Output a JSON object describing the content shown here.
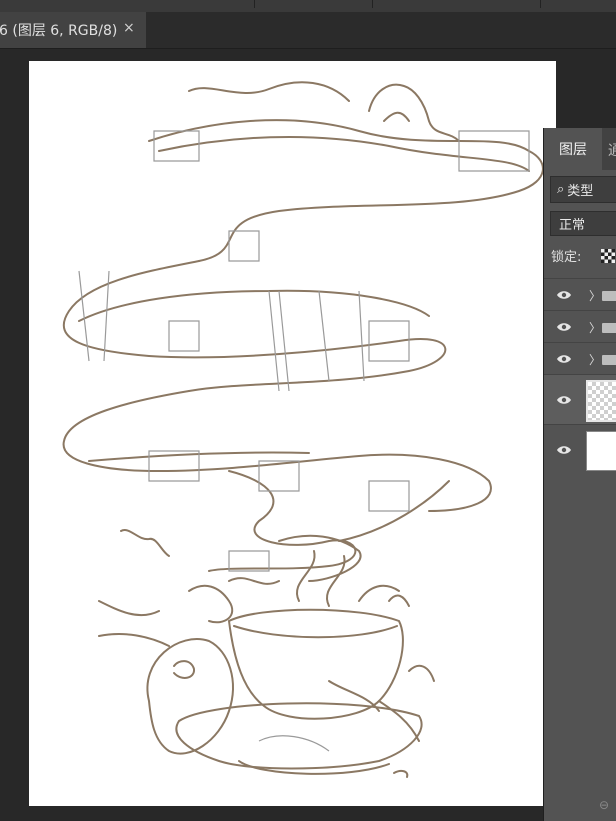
{
  "document_tab": {
    "title": "6 (图层 6, RGB/8)",
    "close_glyph": "×"
  },
  "layers_panel": {
    "tab_label": "图层",
    "tab2_label": "通",
    "filter": {
      "icon": "search-icon",
      "label": "类型"
    },
    "blend_mode": "正常",
    "lock_label": "锁定:",
    "layers": [
      {
        "kind": "group",
        "visible": true,
        "icon": "folder-icon"
      },
      {
        "kind": "group",
        "visible": true,
        "icon": "folder-icon"
      },
      {
        "kind": "group",
        "visible": true,
        "icon": "folder-icon"
      },
      {
        "kind": "pixel",
        "visible": true,
        "thumbnail": "transparent",
        "selected": true
      },
      {
        "kind": "pixel",
        "visible": true,
        "thumbnail": "white",
        "selected": false
      }
    ]
  },
  "colors": {
    "sketch_stroke": "#8b7863",
    "canvas_bg": "#ffffff",
    "workspace_bg": "#282828",
    "panel_bg": "#535353"
  }
}
